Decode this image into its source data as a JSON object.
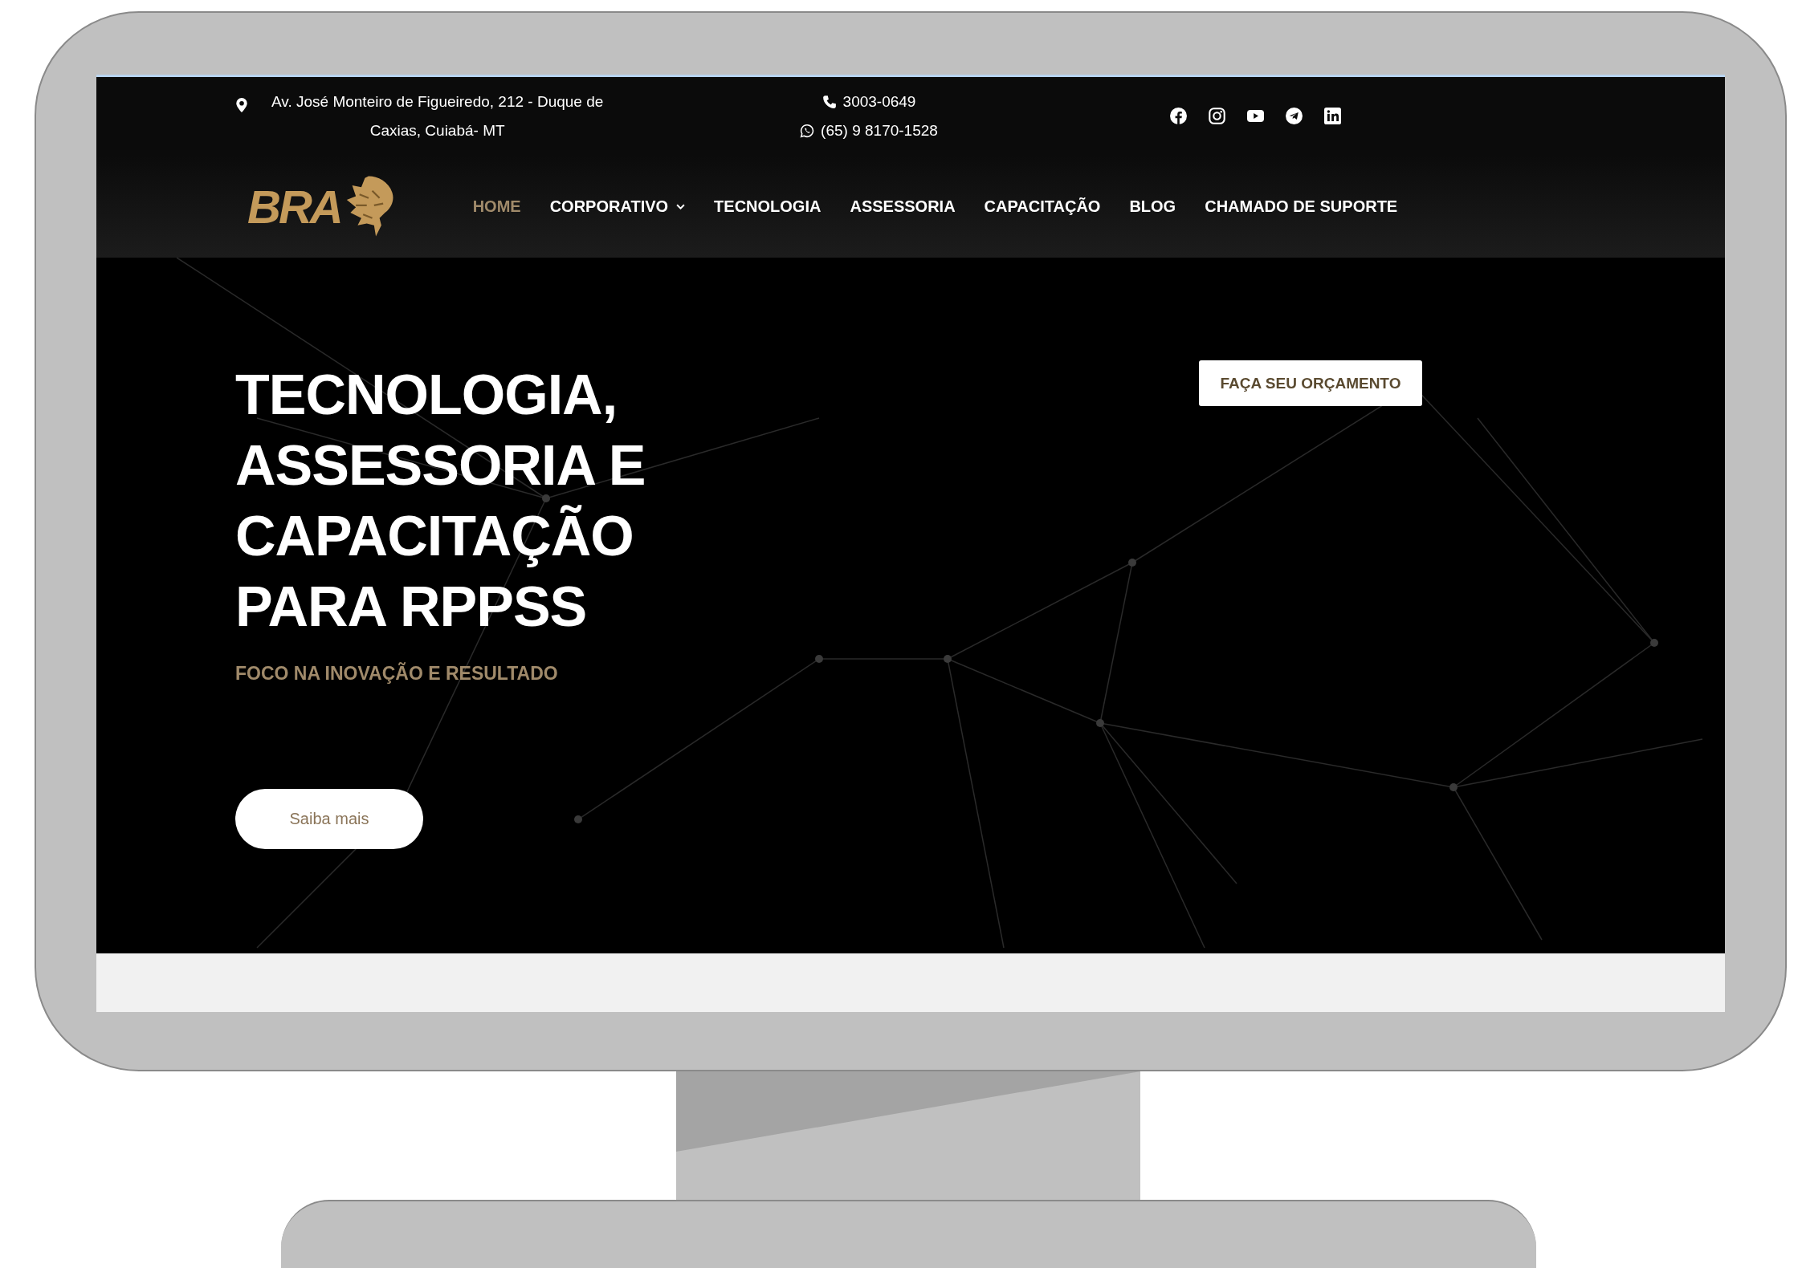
{
  "top_bar": {
    "address_lines": [
      "Av. José Monteiro de Figueiredo, 212 - Duque de",
      "Caxias, Cuiabá- MT"
    ],
    "phones": [
      {
        "kind": "phone",
        "number": "3003-0649"
      },
      {
        "kind": "whatsapp",
        "number": "(65) 9 8170-1528"
      }
    ],
    "social": [
      {
        "kind": "facebook"
      },
      {
        "kind": "instagram"
      },
      {
        "kind": "youtube"
      },
      {
        "kind": "telegram"
      },
      {
        "kind": "linkedin"
      }
    ]
  },
  "logo": {
    "text": "BRA"
  },
  "nav": [
    {
      "label": "HOME",
      "selected": true,
      "has_dropdown": false
    },
    {
      "label": "CORPORATIVO",
      "selected": false,
      "has_dropdown": true
    },
    {
      "label": "TECNOLOGIA",
      "selected": false,
      "has_dropdown": false
    },
    {
      "label": "ASSESSORIA",
      "selected": false,
      "has_dropdown": false
    },
    {
      "label": "CAPACITAÇÃO",
      "selected": false,
      "has_dropdown": false
    },
    {
      "label": "BLOG",
      "selected": false,
      "has_dropdown": false
    },
    {
      "label": "CHAMADO DE SUPORTE",
      "selected": false,
      "has_dropdown": false
    }
  ],
  "hero": {
    "title_lines": [
      "TECNOLOGIA,",
      "ASSESSORIA E",
      "CAPACITAÇÃO",
      "PARA RPPSS"
    ],
    "subtitle": "FOCO NA INOVAÇÃO E RESULTADO",
    "primary_button": "Saiba mais",
    "quote_button": "FAÇA SEU ORÇAMENTO"
  }
}
